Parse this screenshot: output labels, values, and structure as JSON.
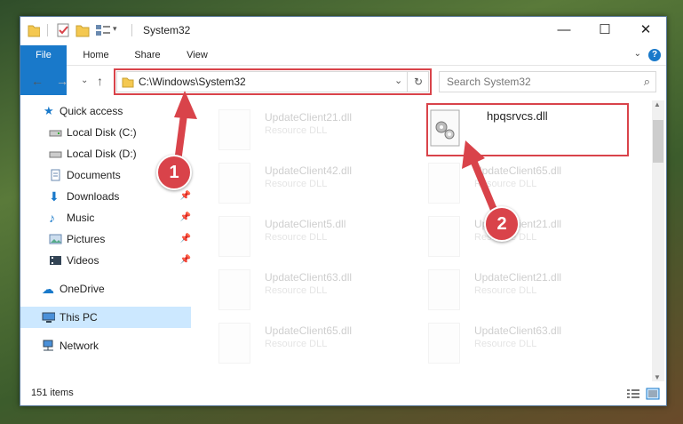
{
  "window": {
    "title": "System32",
    "controls": {
      "minimize": "—",
      "maximize": "☐",
      "close": "✕"
    }
  },
  "ribbon": {
    "tabs": [
      "File",
      "Home",
      "Share",
      "View"
    ],
    "help": "?"
  },
  "navigation": {
    "address_path": "C:\\Windows\\System32",
    "search_placeholder": "Search System32"
  },
  "sidebar": {
    "items": [
      {
        "label": "Quick access",
        "icon": "star-icon",
        "pinned": false
      },
      {
        "label": "Local Disk (C:)",
        "icon": "drive-icon",
        "pinned": false
      },
      {
        "label": "Local Disk (D:)",
        "icon": "drive-icon",
        "pinned": false
      },
      {
        "label": "Documents",
        "icon": "documents-icon",
        "pinned": false
      },
      {
        "label": "Downloads",
        "icon": "download-icon",
        "pinned": true
      },
      {
        "label": "Music",
        "icon": "music-icon",
        "pinned": true
      },
      {
        "label": "Pictures",
        "icon": "pictures-icon",
        "pinned": true
      },
      {
        "label": "Videos",
        "icon": "videos-icon",
        "pinned": true
      },
      {
        "label": "OneDrive",
        "icon": "cloud-icon",
        "pinned": false
      },
      {
        "label": "This PC",
        "icon": "pc-icon",
        "pinned": false,
        "selected": true
      },
      {
        "label": "Network",
        "icon": "network-icon",
        "pinned": false
      }
    ]
  },
  "files": {
    "highlighted": {
      "name": "hpqsrvcs.dll"
    },
    "left_column": [
      {
        "name": "UpdateClient21.dll",
        "type": "Resource DLL"
      },
      {
        "name": "UpdateClient42.dll",
        "type": "Resource DLL"
      },
      {
        "name": "UpdateClient5.dll",
        "type": "Resource DLL"
      },
      {
        "name": "UpdateClient63.dll",
        "type": "Resource DLL"
      },
      {
        "name": "UpdateClient65.dll",
        "type": "Resource DLL"
      }
    ],
    "right_column": [
      {
        "name": "UpdateClient65.dll",
        "type": "Resource DLL"
      },
      {
        "name": "UpdateClient21.dll",
        "type": "Resource DLL"
      },
      {
        "name": "UpdateClient21.dll",
        "type": "Resource DLL"
      },
      {
        "name": "UpdateClient63.dll",
        "type": "Resource DLL"
      }
    ]
  },
  "status": {
    "item_count": "151 items"
  },
  "annotations": {
    "step1": "1",
    "step2": "2",
    "color": "#d9434a"
  }
}
